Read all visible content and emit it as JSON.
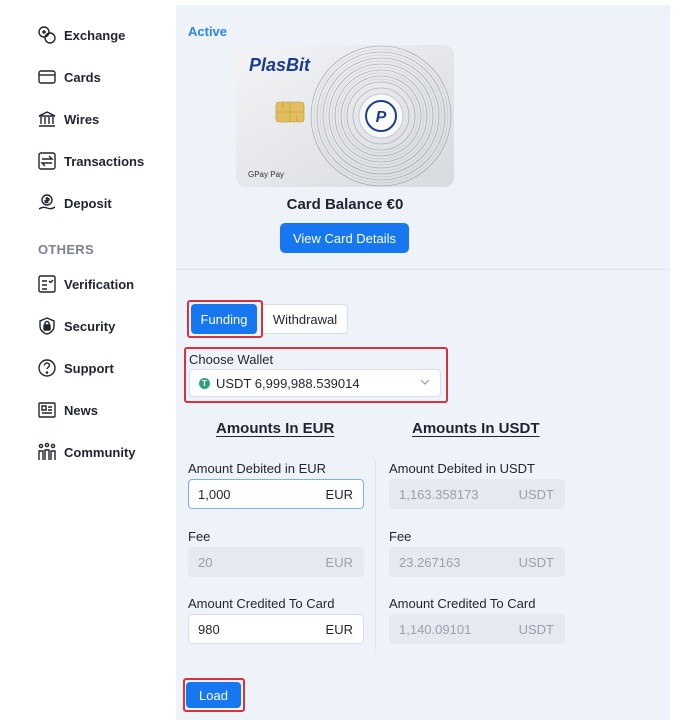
{
  "sidebar": {
    "items": [
      {
        "label": "Exchange",
        "icon": "exchange-icon"
      },
      {
        "label": "Cards",
        "icon": "card-icon"
      },
      {
        "label": "Wires",
        "icon": "bank-icon"
      },
      {
        "label": "Transactions",
        "icon": "transactions-icon"
      },
      {
        "label": "Deposit",
        "icon": "deposit-icon"
      }
    ],
    "section_title": "OTHERS",
    "other_items": [
      {
        "label": "Verification",
        "icon": "verification-icon"
      },
      {
        "label": "Security",
        "icon": "shield-lock-icon"
      },
      {
        "label": "Support",
        "icon": "help-icon"
      },
      {
        "label": "News",
        "icon": "news-icon"
      },
      {
        "label": "Community",
        "icon": "community-icon"
      }
    ]
  },
  "card": {
    "status": "Active",
    "brand": "PlasBit",
    "wallets": "GPay  Pay",
    "balance_text": "Card Balance €0",
    "view_details_label": "View Card Details"
  },
  "tabs": {
    "funding": "Funding",
    "withdrawal": "Withdrawal",
    "active": "Funding"
  },
  "wallet": {
    "label": "Choose Wallet",
    "selected": "USDT 6,999,988.539014"
  },
  "eur": {
    "title": "Amounts In EUR",
    "debited_label": "Amount Debited in EUR",
    "debited_value": "1,000",
    "debited_currency": "EUR",
    "fee_label": "Fee",
    "fee_value": "20",
    "fee_currency": "EUR",
    "credited_label": "Amount Credited To Card",
    "credited_value": "980",
    "credited_currency": "EUR"
  },
  "usdt": {
    "title": "Amounts In USDT",
    "debited_label": "Amount Debited in USDT",
    "debited_value": "1,163.358173",
    "debited_currency": "USDT",
    "fee_label": "Fee",
    "fee_value": "23.267163",
    "fee_currency": "USDT",
    "credited_label": "Amount Credited To Card",
    "credited_value": "1,140.09101",
    "credited_currency": "USDT"
  },
  "load_label": "Load",
  "colors": {
    "accent": "#1677f0",
    "highlight": "#d7323f",
    "panel_bg": "#eef2f9"
  }
}
